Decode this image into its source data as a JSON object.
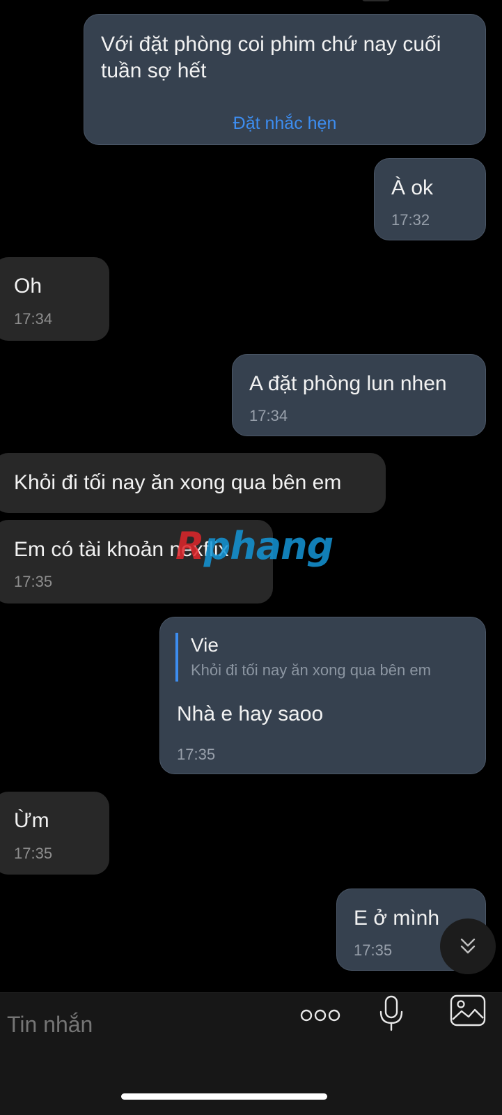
{
  "messages": [
    {
      "text": "Với đặt phòng coi phim chứ nay cuối\ntuần sợ hết",
      "reminder_action": "Đặt nhắc hẹn"
    },
    {
      "text": "À ok",
      "time": "17:32"
    },
    {
      "text": "Oh",
      "time": "17:34"
    },
    {
      "text": "A đặt phòng lun nhen",
      "time": "17:34"
    },
    {
      "text": "Khỏi đi tối nay ăn xong qua bên em"
    },
    {
      "text": "Em có tài khoản nexflix",
      "time": "17:35"
    },
    {
      "text": "Nhà e hay saoo",
      "time": "17:35",
      "quote_author": "Vie",
      "quote_text": "Khỏi đi tối nay ăn xong qua bên em"
    },
    {
      "text": "Ừm",
      "time": "17:35"
    },
    {
      "text": "E ở mình",
      "time": "17:35"
    }
  ],
  "watermark": {
    "first_letter": "R",
    "rest": "phang"
  },
  "composer": {
    "placeholder": "Tin nhắn",
    "icons": [
      "more-icon",
      "microphone-icon",
      "image-icon"
    ]
  },
  "scroll_button_icon": "chevron-double-down-icon",
  "colors": {
    "outgoing_bubble": "#36414f",
    "incoming_bubble": "#282828",
    "accent": "#3d8df0",
    "background": "#000000"
  }
}
